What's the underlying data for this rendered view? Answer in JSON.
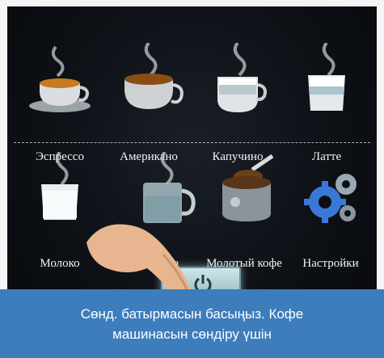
{
  "menu": {
    "row1": [
      {
        "label": "Эспрессо",
        "icon": "espresso-cup-icon"
      },
      {
        "label": "Американо",
        "icon": "americano-cup-icon"
      },
      {
        "label": "Капучино",
        "icon": "cappuccino-cup-icon"
      },
      {
        "label": "Латте",
        "icon": "latte-glass-icon"
      }
    ],
    "row2": [
      {
        "label": "Молоко",
        "icon": "milk-glass-icon"
      },
      {
        "label": "вода",
        "icon": "water-mug-icon"
      },
      {
        "label": "Молотый кофе",
        "icon": "ground-coffee-icon"
      },
      {
        "label": "Настройки",
        "icon": "settings-gears-icon"
      }
    ]
  },
  "power_button": {
    "icon": "power-icon"
  },
  "caption": {
    "line1": "Сөнд. батырмасын басыңыз. Кофе",
    "line2": "машинасын сөндіру үшін"
  },
  "colors": {
    "caption_bg": "#3d7dbc",
    "screen_bg": "#0c0f14",
    "gear_blue": "#3a78d8"
  }
}
